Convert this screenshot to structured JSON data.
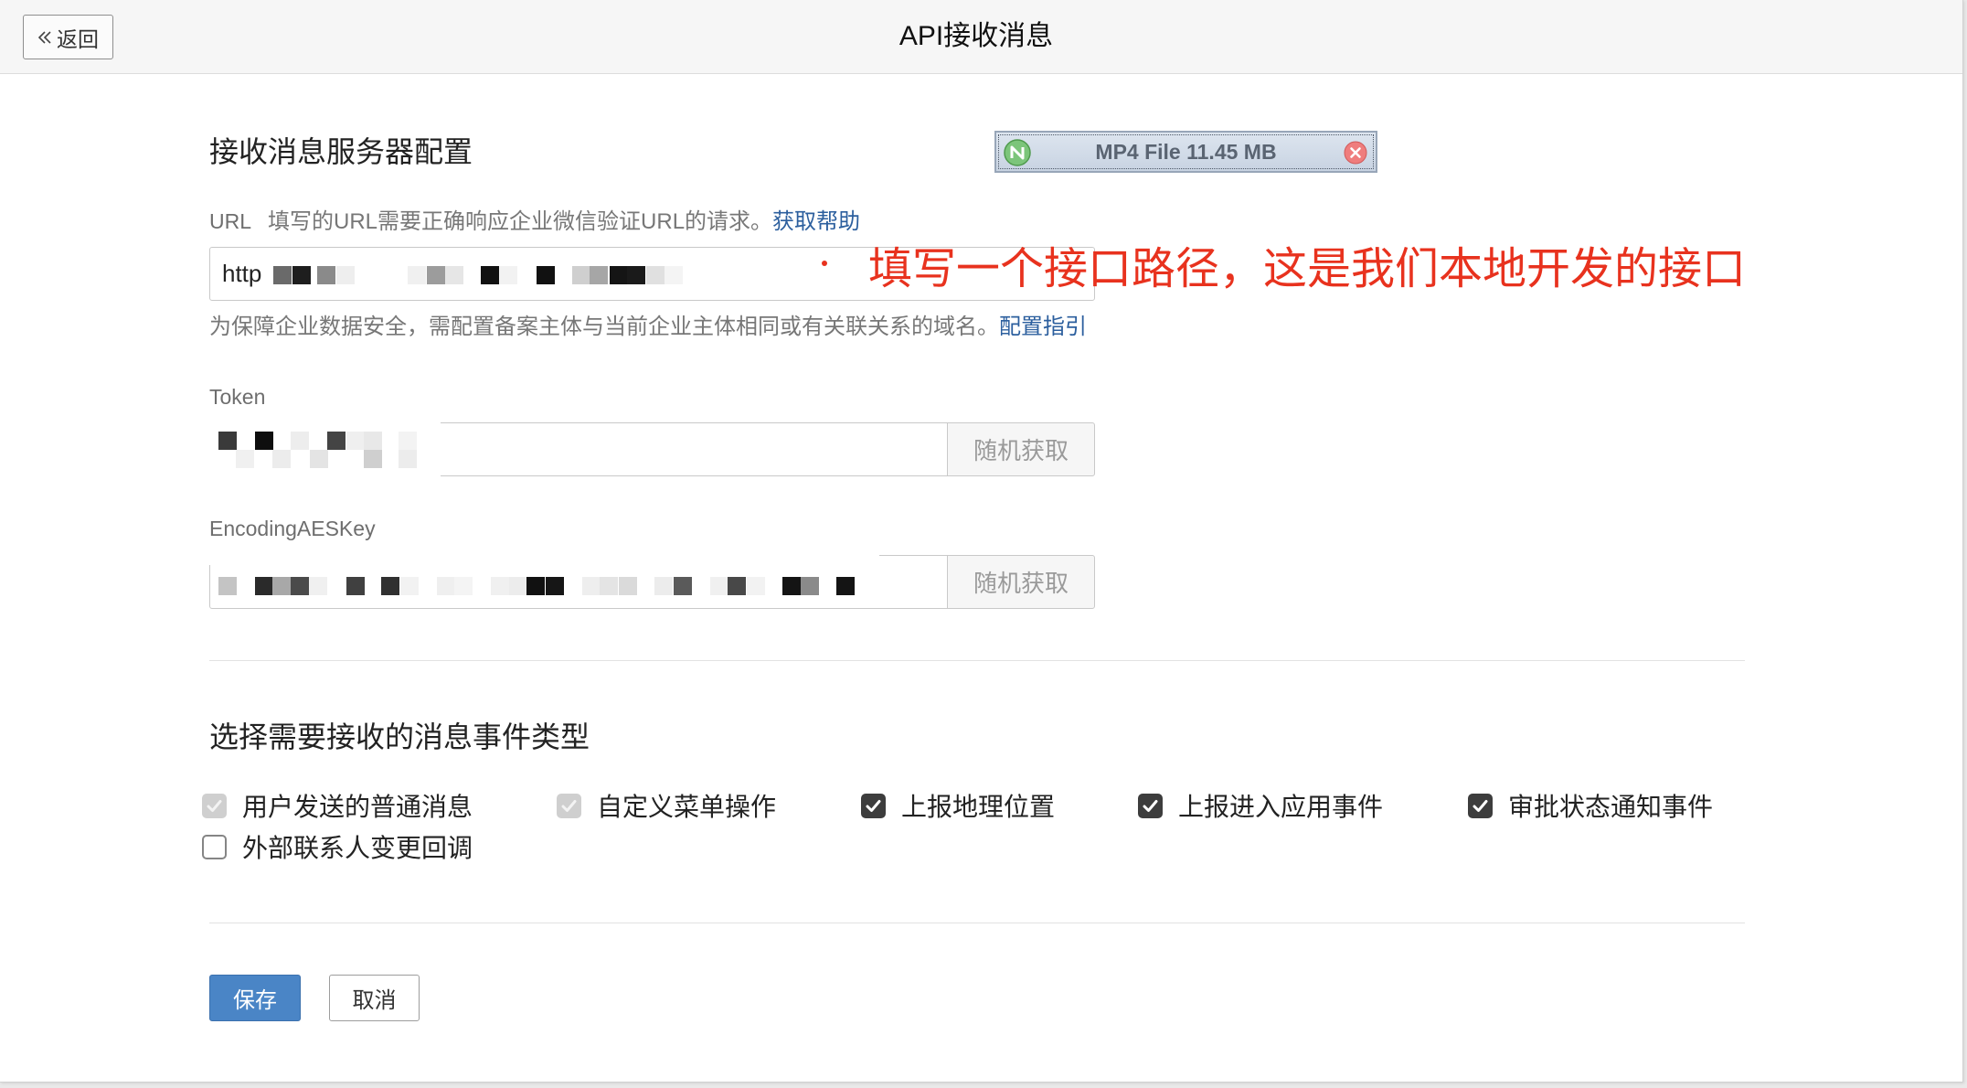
{
  "header": {
    "back_label": "返回",
    "title": "API接收消息"
  },
  "download_badge": {
    "label": "MP4 File 11.45 MB"
  },
  "server_config": {
    "title": "接收消息服务器配置",
    "url": {
      "label": "URL",
      "hint": "填写的URL需要正确响应企业微信验证URL的请求。",
      "help_link": "获取帮助",
      "value": "http",
      "domain_hint": "为保障企业数据安全，需配置备案主体与当前企业主体相同或有关联关系的域名。",
      "guide_link": "配置指引"
    },
    "token": {
      "label": "Token",
      "random_button": "随机获取"
    },
    "aes_key": {
      "label": "EncodingAESKey",
      "random_button": "随机获取"
    }
  },
  "annotation": {
    "text": "填写一个接口路径，这是我们本地开发的接口"
  },
  "events": {
    "title": "选择需要接收的消息事件类型",
    "options": [
      {
        "label": "用户发送的普通消息",
        "checked": true,
        "disabled": true
      },
      {
        "label": "自定义菜单操作",
        "checked": true,
        "disabled": true
      },
      {
        "label": "上报地理位置",
        "checked": true,
        "disabled": false
      },
      {
        "label": "上报进入应用事件",
        "checked": true,
        "disabled": false
      },
      {
        "label": "审批状态通知事件",
        "checked": true,
        "disabled": false
      },
      {
        "label": "外部联系人变更回调",
        "checked": false,
        "disabled": false
      }
    ]
  },
  "actions": {
    "save_label": "保存",
    "cancel_label": "取消"
  },
  "icons": {
    "back": "double-chevron-left-icon",
    "download": "download-manager-icon",
    "close": "close-circle-icon",
    "check": "checkmark-icon"
  },
  "colors": {
    "link": "#2c5f9e",
    "primary_button": "#4a85c6",
    "annotation": "#e8321e",
    "checkbox_checked": "#3d3d3d",
    "checkbox_disabled": "#cfcfcf"
  }
}
